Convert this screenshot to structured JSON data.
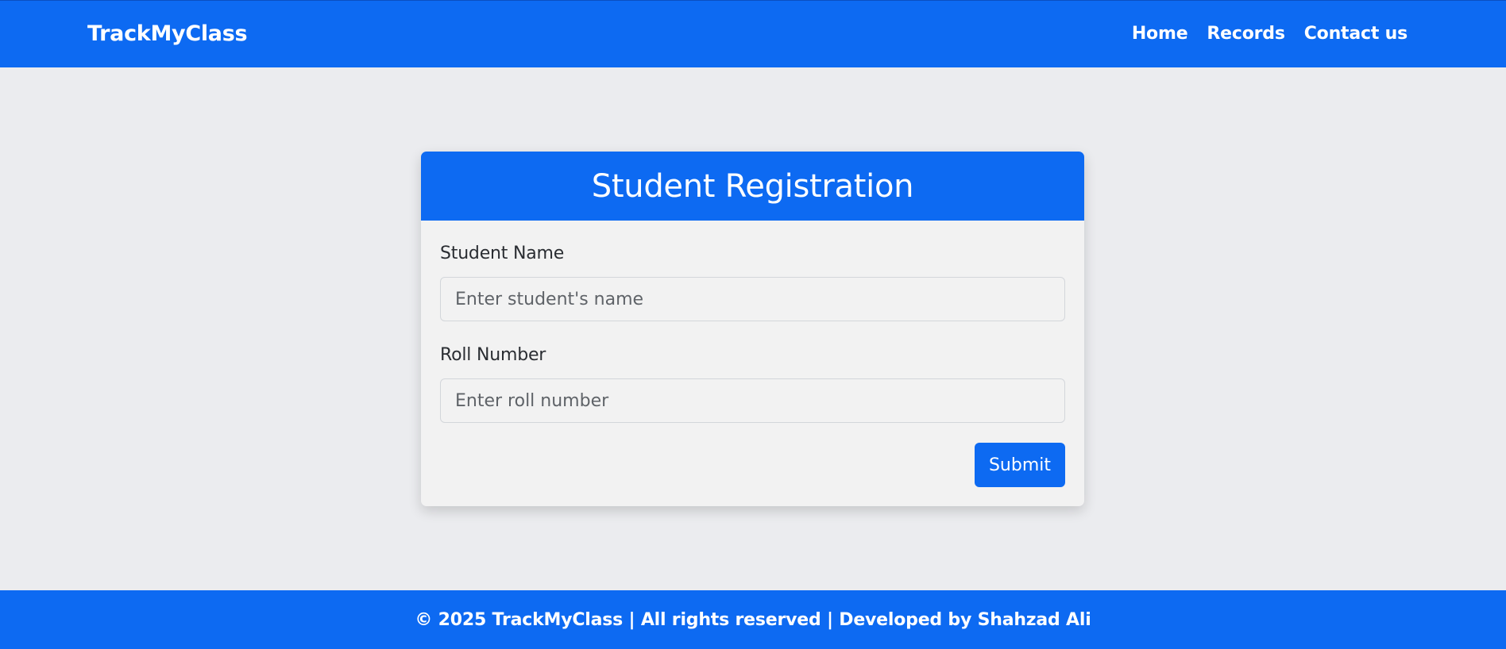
{
  "navbar": {
    "brand": "TrackMyClass",
    "links": [
      "Home",
      "Records",
      "Contact us"
    ]
  },
  "form": {
    "title": "Student Registration",
    "name_label": "Student Name",
    "name_placeholder": "Enter student's name",
    "name_value": "",
    "roll_label": "Roll Number",
    "roll_placeholder": "Enter roll number",
    "roll_value": "",
    "submit_label": "Submit"
  },
  "footer": {
    "text": "© 2025 TrackMyClass | All rights reserved | Developed by Shahzad Ali"
  },
  "colors": {
    "primary": "#0d6af2",
    "background": "#ebecef",
    "card": "#f2f2f2"
  }
}
